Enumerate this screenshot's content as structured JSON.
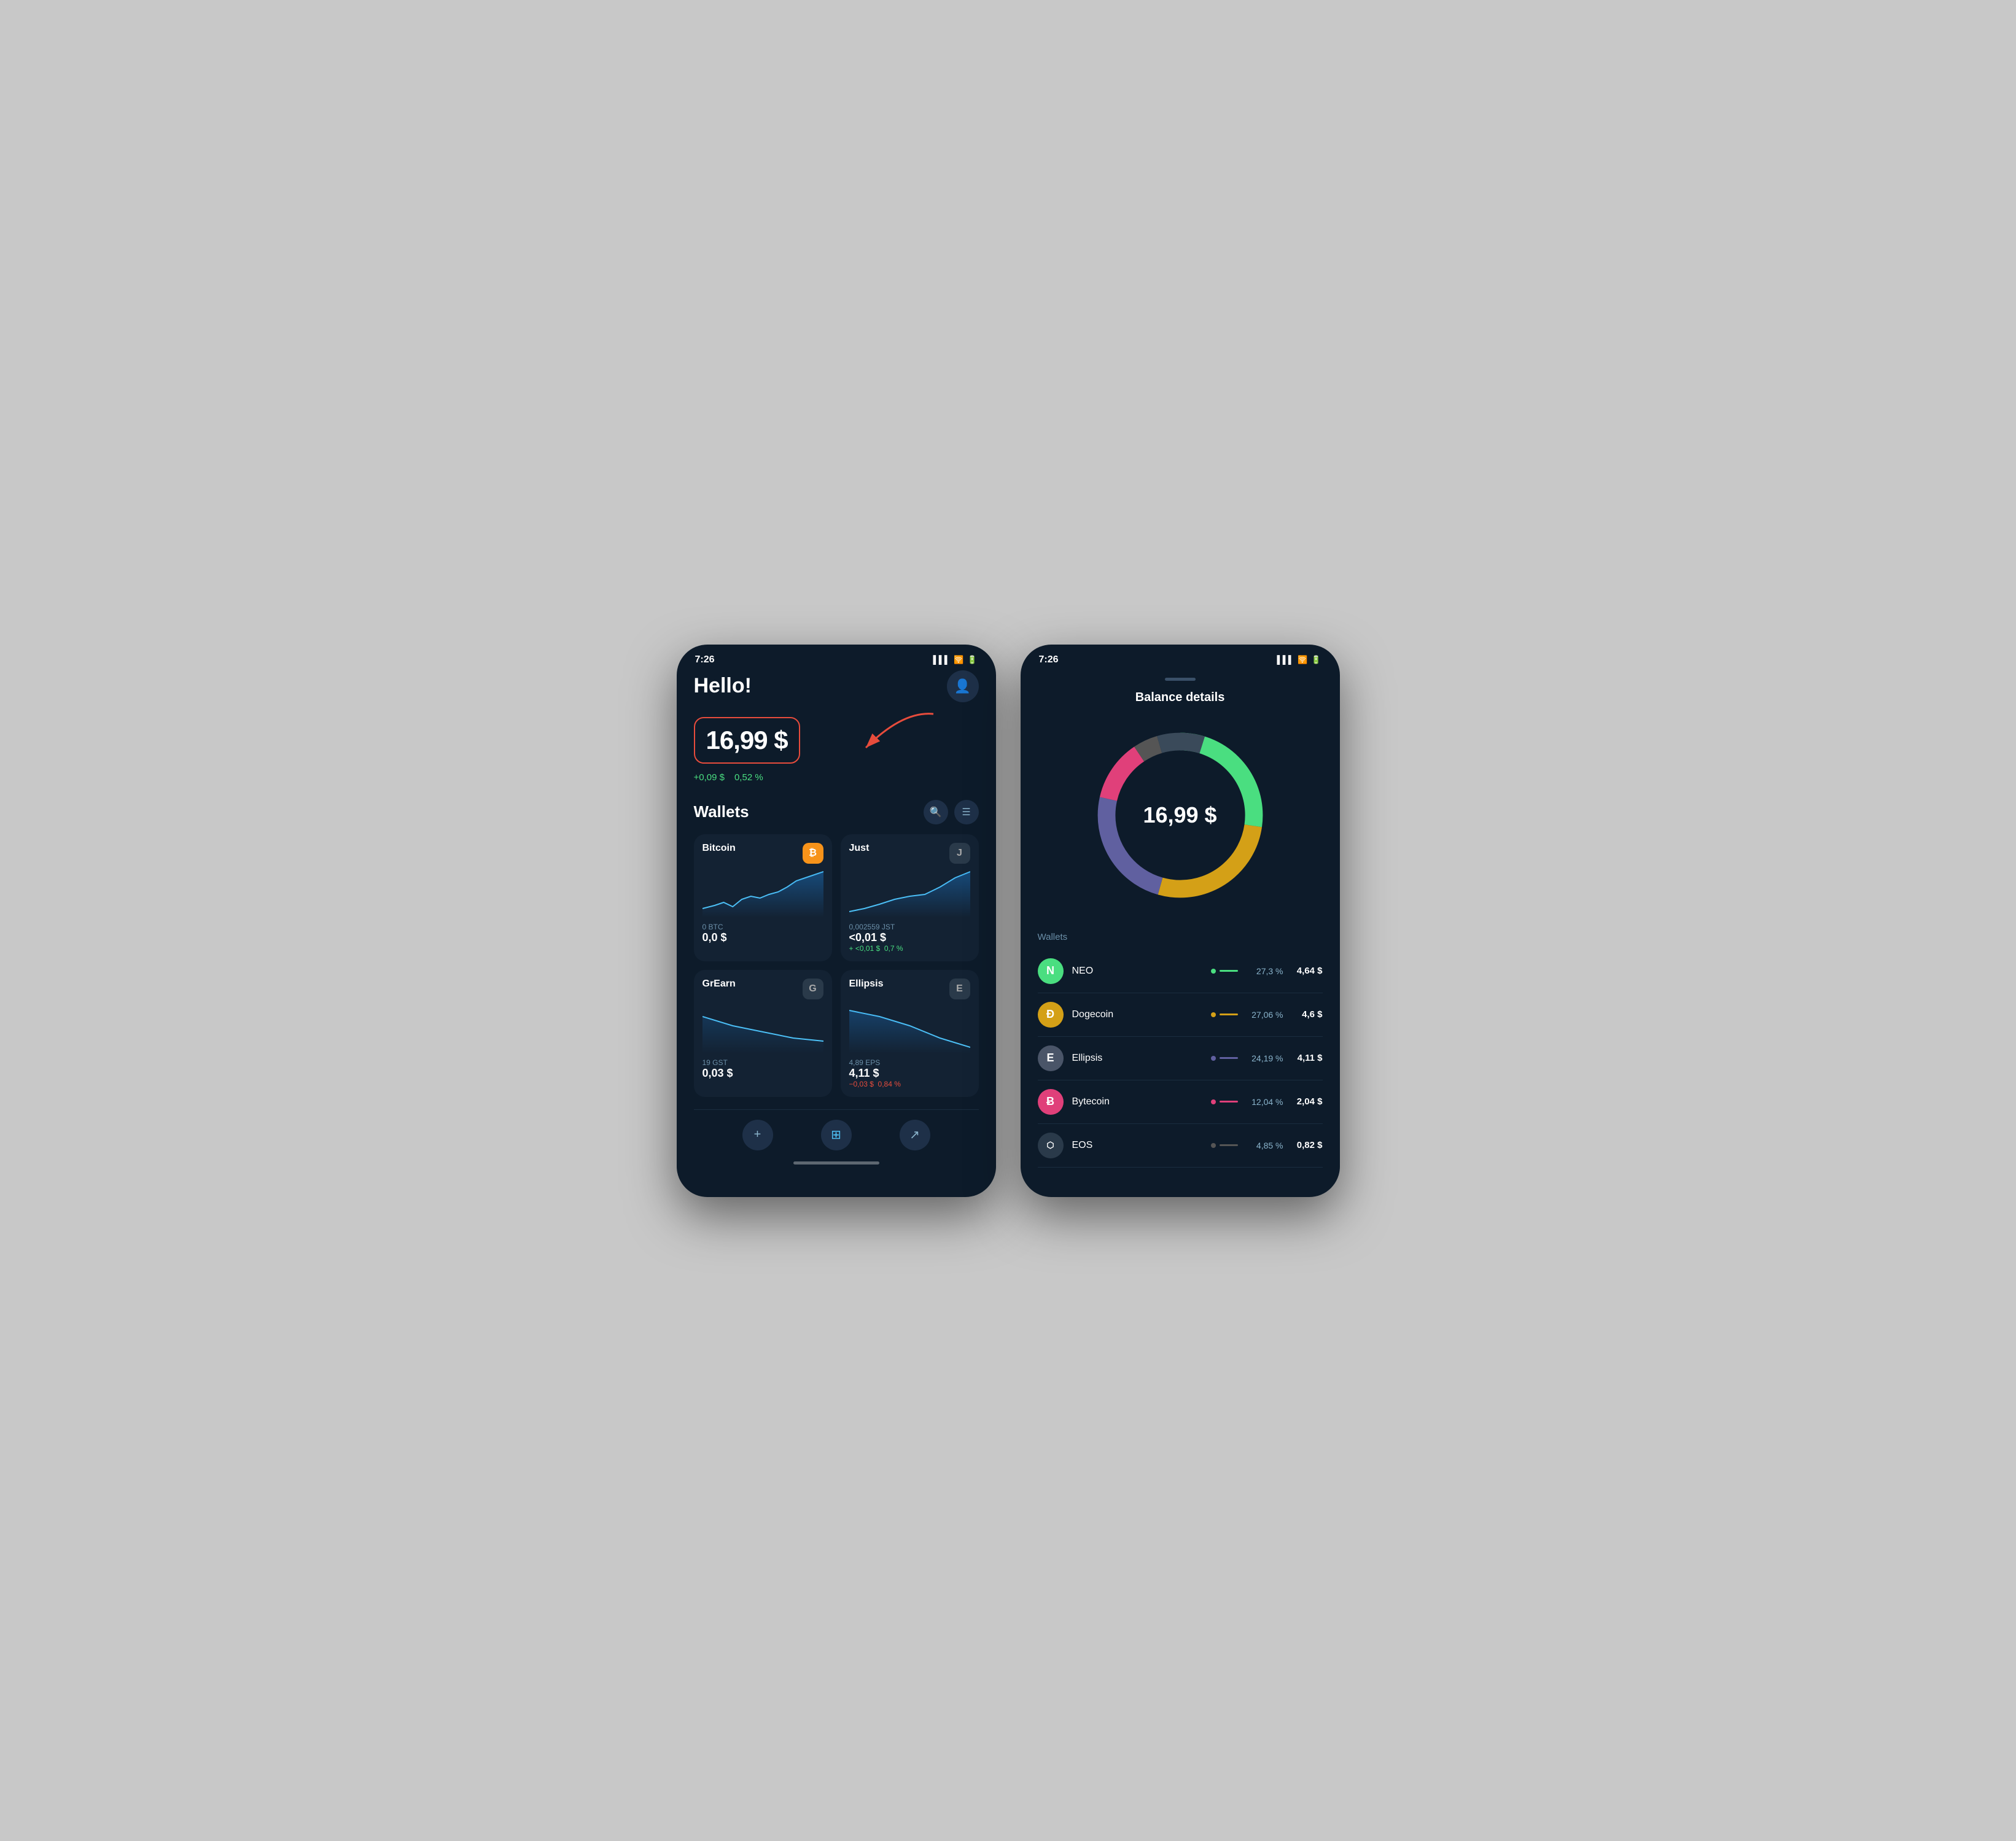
{
  "phone1": {
    "status_time": "7:26",
    "greeting": "Hello!",
    "balance": "16,99 $",
    "change_amount": "+0,09 $",
    "change_pct": "0,52 %",
    "wallets_title": "Wallets",
    "wallets": [
      {
        "name": "Bitcoin",
        "icon": "₿",
        "icon_class": "icon-btc",
        "amount_label": "0 BTC",
        "amount": "0,0 $",
        "change": "",
        "change_class": ""
      },
      {
        "name": "Just",
        "icon": "J",
        "icon_class": "icon-just",
        "amount_label": "0,002559 JST",
        "amount": "<0,01 $",
        "change": "+ <0,01 $   0,7 %",
        "change_class": "wallet-change-pos"
      },
      {
        "name": "GrEarn",
        "icon": "G",
        "icon_class": "icon-grearn",
        "amount_label": "19 GST",
        "amount": "0,03 $",
        "change": "",
        "change_class": ""
      },
      {
        "name": "Ellipsis",
        "icon": "E",
        "icon_class": "icon-ellipsis",
        "amount_label": "4,89 EPS",
        "amount": "4,11 $",
        "change": "−0,03 $   0,84 %",
        "change_class": "wallet-change-neg"
      }
    ],
    "nav": {
      "add": "+",
      "home": "⊞",
      "share": "↗"
    }
  },
  "phone2": {
    "status_time": "7:26",
    "title": "Balance details",
    "balance": "16,99 $",
    "wallets_label": "Wallets",
    "donut_segments": [
      {
        "color": "#4ade80",
        "pct": 27.3,
        "offset": 0
      },
      {
        "color": "#d4a017",
        "pct": 27.06,
        "offset": 27.3
      },
      {
        "color": "#6060a0",
        "pct": 24.19,
        "offset": 54.36
      },
      {
        "color": "#e0407a",
        "pct": 12.04,
        "offset": 78.55
      },
      {
        "color": "#555555",
        "pct": 4.85,
        "offset": 90.59
      },
      {
        "color": "#2a3a4a",
        "pct": 9.41,
        "offset": 95.44
      }
    ],
    "wallets": [
      {
        "name": "NEO",
        "icon": "N",
        "icon_class": "icon-neo",
        "bar_class": "col-neo",
        "pct": "27,3 %",
        "value": "4,64 $"
      },
      {
        "name": "Dogecoin",
        "icon": "Đ",
        "icon_class": "icon-doge",
        "bar_class": "col-doge",
        "pct": "27,06 %",
        "value": "4,6 $"
      },
      {
        "name": "Ellipsis",
        "icon": "E",
        "icon_class": "icon-ellipsis2",
        "bar_class": "col-ellipsis",
        "pct": "24,19 %",
        "value": "4,11 $"
      },
      {
        "name": "Bytecoin",
        "icon": "Ƀ",
        "icon_class": "icon-bytecoin",
        "bar_class": "col-bytecoin",
        "pct": "12,04 %",
        "value": "2,04 $"
      },
      {
        "name": "EOS",
        "icon": "⬡",
        "icon_class": "icon-eos",
        "bar_class": "col-eos",
        "pct": "4,85 %",
        "value": "0,82 $"
      }
    ]
  }
}
